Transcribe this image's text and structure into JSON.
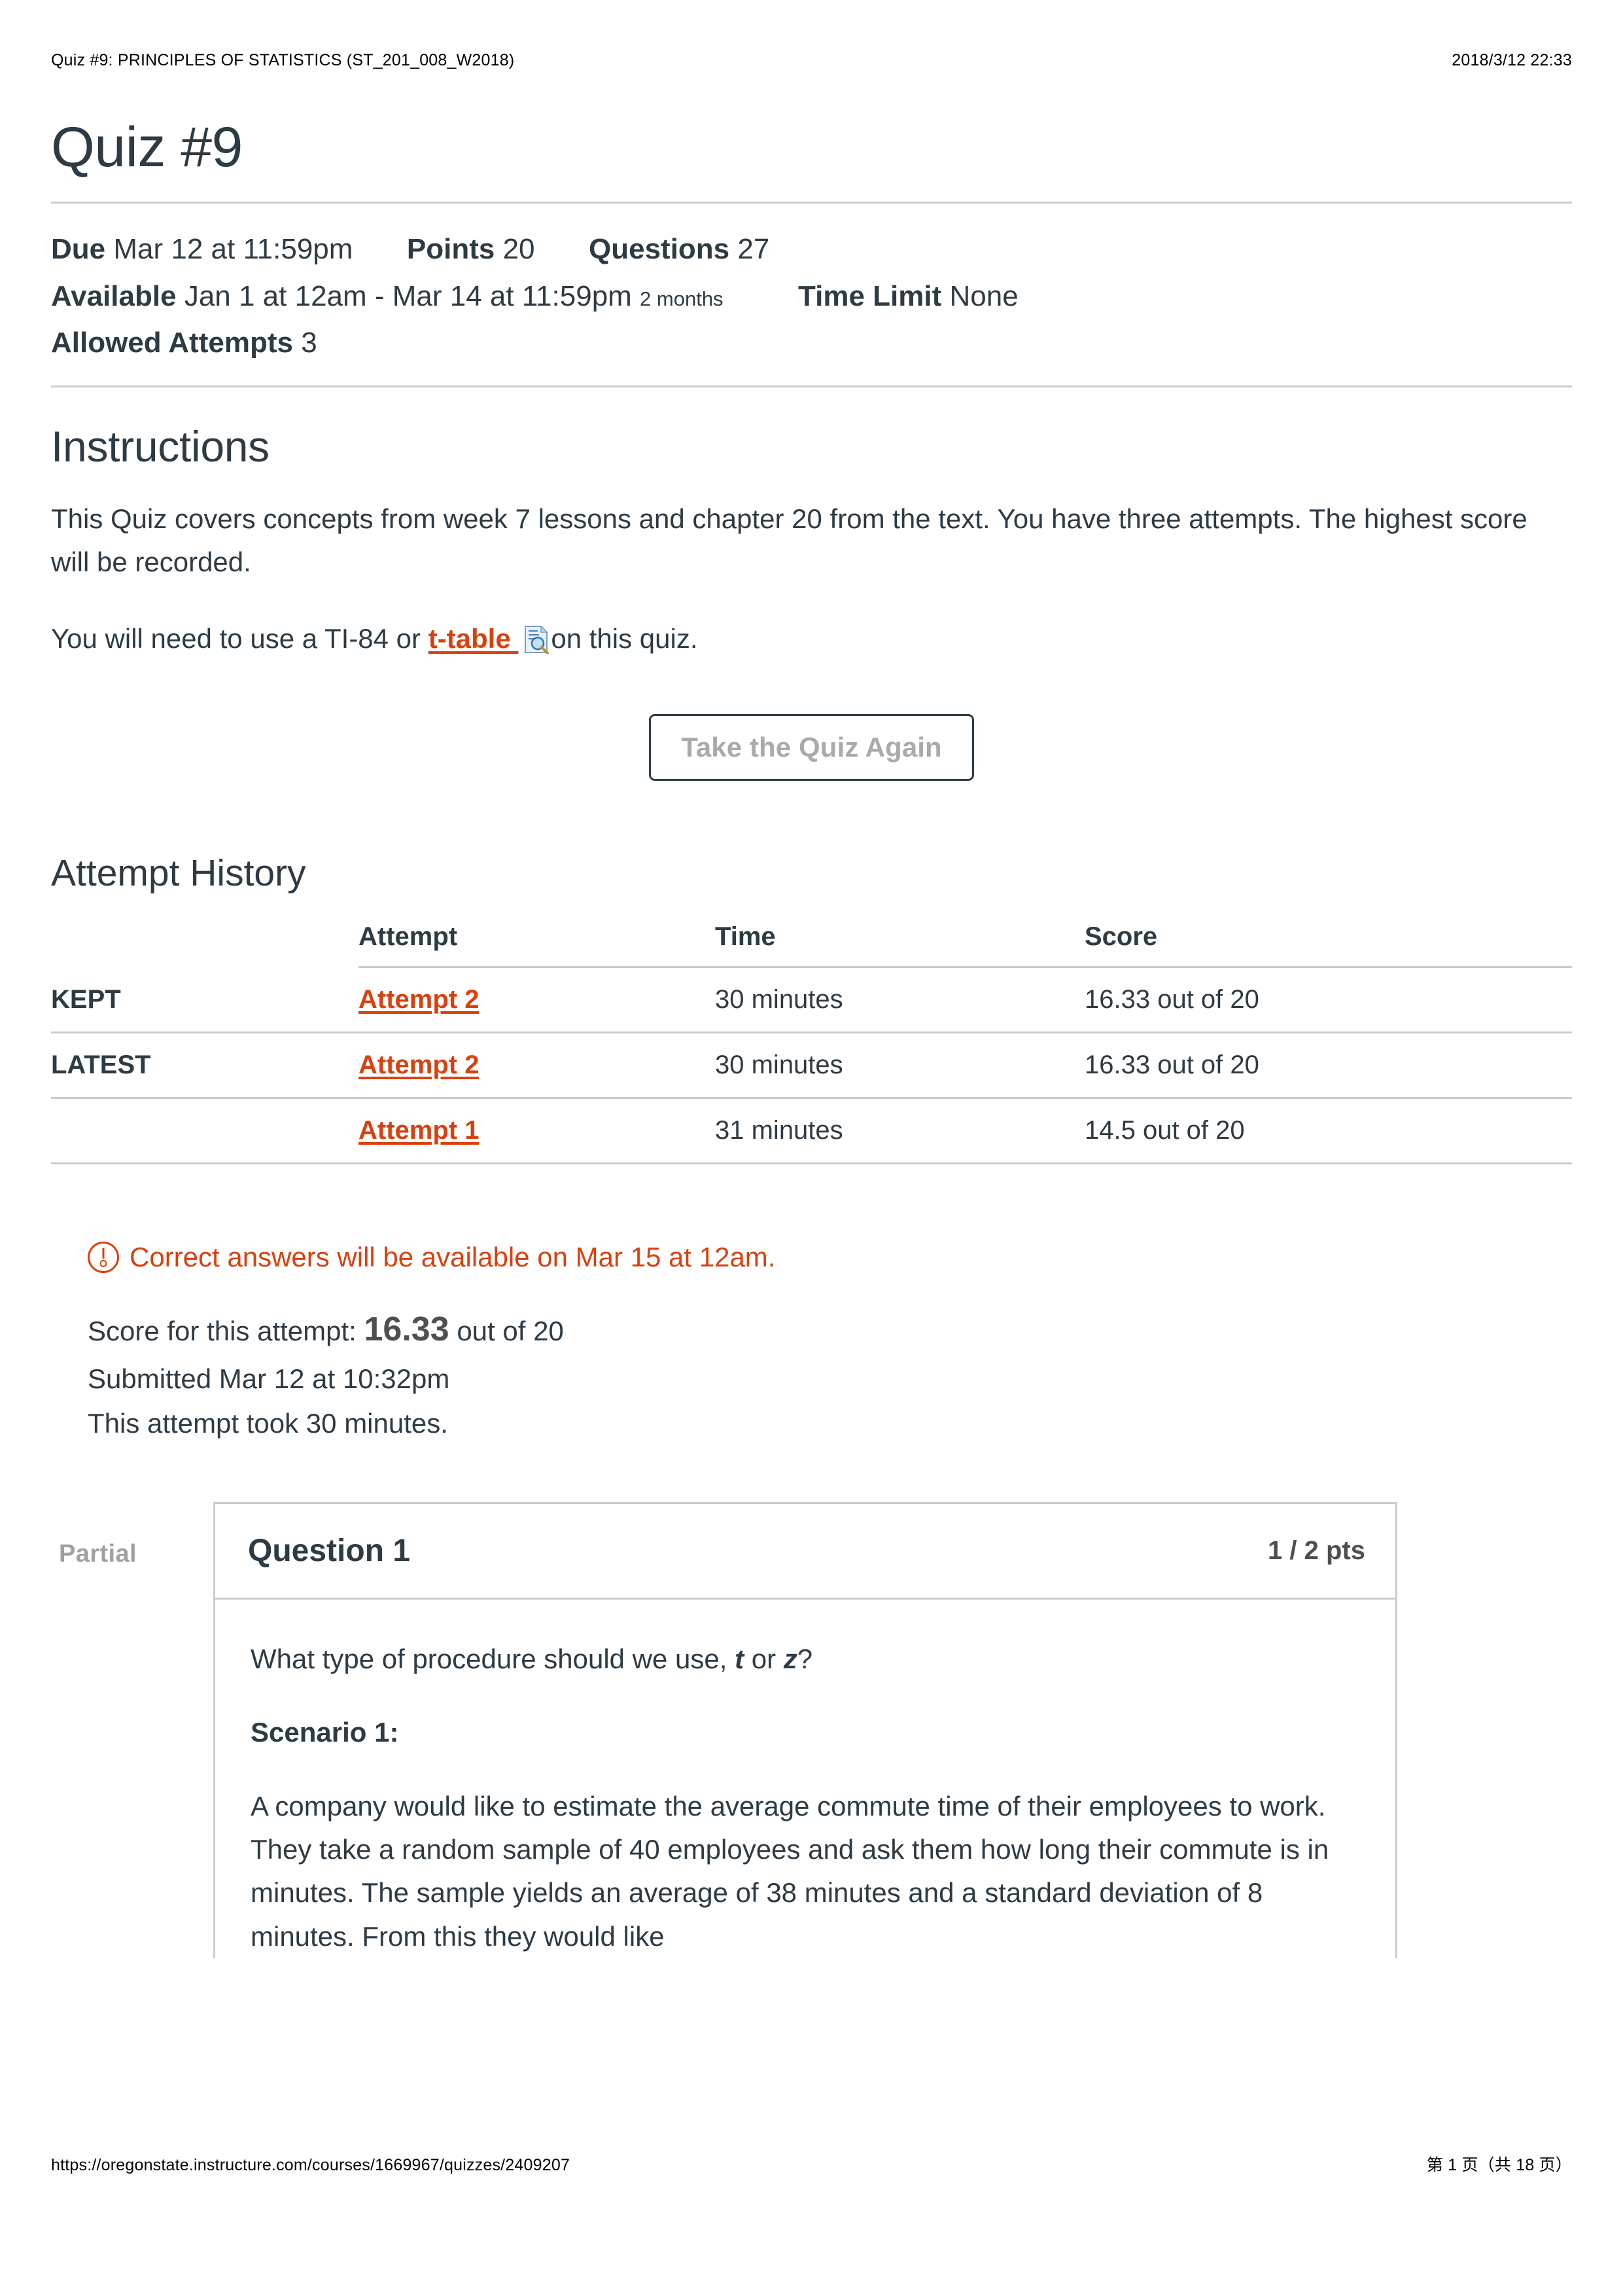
{
  "print": {
    "header_left": "Quiz #9: PRINCIPLES OF STATISTICS (ST_201_008_W2018)",
    "header_right": "2018/3/12 22:33",
    "footer_url": "https://oregonstate.instructure.com/courses/1669967/quizzes/2409207",
    "footer_pages": "第 1 页（共 18 页）"
  },
  "quiz": {
    "title": "Quiz #9",
    "meta": {
      "due_label": "Due",
      "due_value": "Mar 12 at 11:59pm",
      "points_label": "Points",
      "points_value": "20",
      "questions_label": "Questions",
      "questions_value": "27",
      "available_label": "Available",
      "available_value": "Jan 1 at 12am - Mar 14 at 11:59pm",
      "available_duration": "2 months",
      "time_limit_label": "Time Limit",
      "time_limit_value": "None",
      "allowed_attempts_label": "Allowed Attempts",
      "allowed_attempts_value": "3"
    }
  },
  "instructions": {
    "heading": "Instructions",
    "paragraph1": "This Quiz covers concepts from week 7 lessons and chapter 20 from the text. You have three attempts. The highest score will be recorded.",
    "para2_before": "You will need to use a TI-84 or ",
    "para2_link": "t-table ",
    "para2_after": "on this quiz.",
    "file_icon_name": "document-preview-icon",
    "take_again_button": "Take the Quiz Again"
  },
  "attempt_history": {
    "heading": "Attempt History",
    "columns": [
      "",
      "Attempt",
      "Time",
      "Score"
    ],
    "rows": [
      {
        "status": "KEPT",
        "attempt": "Attempt 2 ",
        "time": "30 minutes",
        "score": "16.33 out of 20"
      },
      {
        "status": "LATEST",
        "attempt": "Attempt 2 ",
        "time": "30 minutes",
        "score": "16.33 out of 20"
      },
      {
        "status": "",
        "attempt": "Attempt 1 ",
        "time": "31 minutes",
        "score": "14.5 out of 20"
      }
    ]
  },
  "notice": {
    "icon": "warning-circle-icon",
    "text": "Correct answers will be available on Mar 15 at 12am."
  },
  "score_summary": {
    "score_prefix": "Score for this attempt: ",
    "score_value": "16.33",
    "score_suffix": " out of 20",
    "submitted": "Submitted Mar 12 at 10:32pm",
    "duration": "This attempt took 30 minutes."
  },
  "question": {
    "status": "Partial",
    "name": "Question 1",
    "points": "1 / 2 pts",
    "prompt_before": "What type of procedure should we use, ",
    "prompt_var1": "t",
    "prompt_mid": " or ",
    "prompt_var2": "z",
    "prompt_after": "?",
    "scenario_label": "Scenario 1:",
    "scenario_text": "A company would like to estimate the average commute time of their employees to work. They take a random sample of 40 employees and ask them how long their commute is in minutes. The sample yields an average of 38 minutes and a standard deviation of 8 minutes. From this they would like"
  },
  "colors": {
    "link": "#d8410e",
    "text": "#2d3b45",
    "rule": "#c7cdd1",
    "muted": "#a0a0a0"
  }
}
